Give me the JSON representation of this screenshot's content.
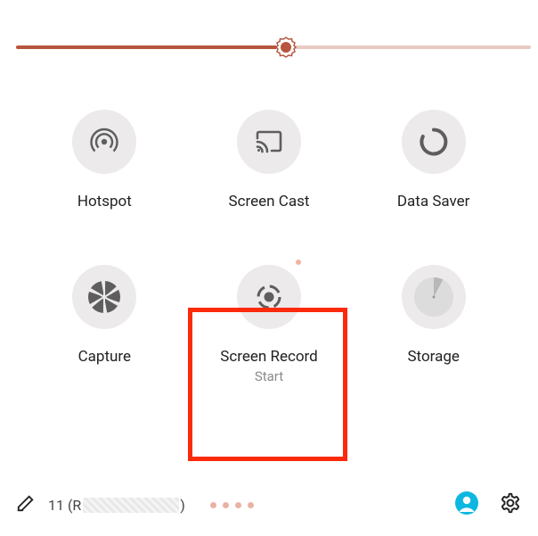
{
  "slider": {
    "value_percent": 52
  },
  "tiles": {
    "hotspot": {
      "label": "Hotspot",
      "icon": "hotspot-icon"
    },
    "screencast": {
      "label": "Screen Cast",
      "icon": "cast-icon"
    },
    "datasaver": {
      "label": "Data Saver",
      "icon": "data-saver-icon"
    },
    "capture": {
      "label": "Capture",
      "icon": "aperture-icon"
    },
    "screenrecord": {
      "label": "Screen Record",
      "sublabel": "Start",
      "icon": "record-icon",
      "highlighted": true
    },
    "storage": {
      "label": "Storage",
      "icon": "storage-icon"
    }
  },
  "bottom": {
    "version_prefix": "11 (R",
    "version_suffix": ")",
    "page_dots": 4
  },
  "colors": {
    "accent": "#b7553e",
    "highlight": "#fb2a0b",
    "user_badge": "#0db7e0"
  }
}
